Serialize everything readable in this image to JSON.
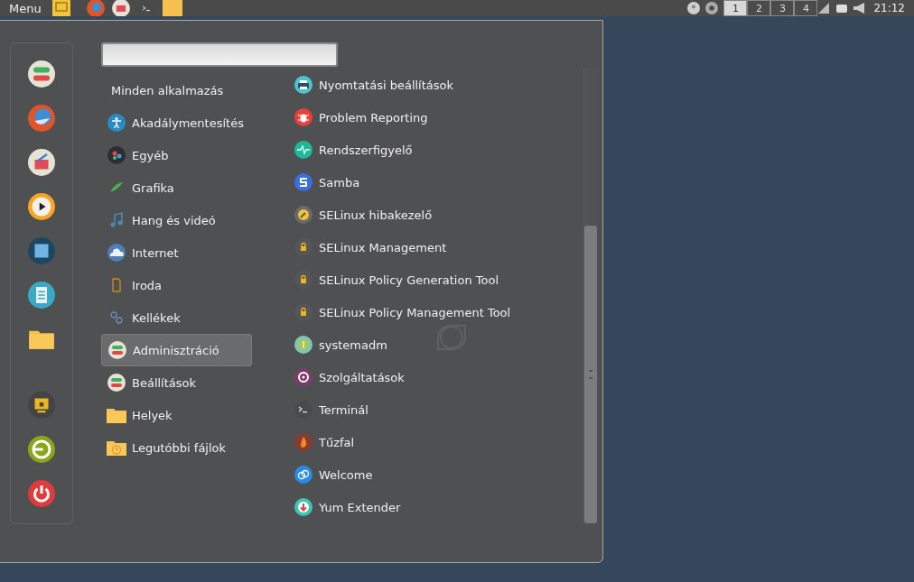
{
  "top_panel": {
    "menu_label": "Menu",
    "workspaces": [
      {
        "label": "1",
        "selected": true
      },
      {
        "label": "2",
        "selected": false
      },
      {
        "label": "3",
        "selected": false
      },
      {
        "label": "4",
        "selected": false
      }
    ],
    "clock": "21:12"
  },
  "menu": {
    "categories": [
      {
        "kind": "all",
        "label": "Minden alkalmazás",
        "selected": false
      },
      {
        "kind": "category",
        "label": "Akadálymentesítés",
        "selected": false
      },
      {
        "kind": "category",
        "label": "Egyéb",
        "selected": false
      },
      {
        "kind": "category",
        "label": "Grafika",
        "selected": false
      },
      {
        "kind": "category",
        "label": "Hang és videó",
        "selected": false
      },
      {
        "kind": "category",
        "label": "Internet",
        "selected": false
      },
      {
        "kind": "category",
        "label": "Iroda",
        "selected": false
      },
      {
        "kind": "category",
        "label": "Kellékek",
        "selected": false
      },
      {
        "kind": "category",
        "label": "Adminisztráció",
        "selected": true
      },
      {
        "kind": "category",
        "label": "Beállítások",
        "selected": false
      },
      {
        "kind": "category",
        "label": "Helyek",
        "selected": false
      },
      {
        "kind": "category",
        "label": "Legutóbbi fájlok",
        "selected": false
      }
    ],
    "applications": [
      "Nyomtatási beállítások",
      "Problem Reporting",
      "Rendszerfigyelő",
      "Samba",
      "SELinux hibakezelő",
      "SELinux Management",
      "SELinux Policy Generation Tool",
      "SELinux Policy Management Tool",
      "systemadm",
      "Szolgáltatások",
      "Terminál",
      "Tűzfal",
      "Welcome",
      "Yum Extender"
    ]
  }
}
